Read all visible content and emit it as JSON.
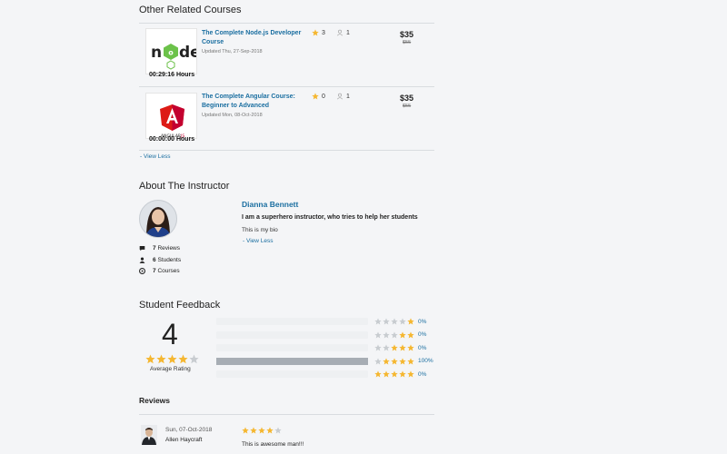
{
  "related": {
    "heading": "Other Related Courses",
    "courses": [
      {
        "title": "The Complete Node.js Developer Course",
        "updated": "Updated Thu, 27-Sep-2018",
        "hours": "00:29:16 Hours",
        "rating": "3",
        "students": "1",
        "price": "$35",
        "old_price": "$55",
        "logo_text": "node"
      },
      {
        "title": "The Complete Angular Course: Beginner to Advanced",
        "updated": "Updated Mon, 08-Oct-2018",
        "hours": "00:00:00 Hours",
        "rating": "0",
        "students": "1",
        "price": "$35",
        "old_price": "$55",
        "logo_text": "ANGULARJS"
      }
    ],
    "view_less": "- View Less"
  },
  "instructor": {
    "heading": "About The Instructor",
    "name": "Dianna Bennett",
    "tagline": "I am a superhero instructor, who tries to help her students",
    "bio": "This is my bio",
    "view_less": "- View Less",
    "stats": [
      {
        "icon": "comment-icon",
        "value": "7",
        "label": "Reviews"
      },
      {
        "icon": "user-icon",
        "value": "6",
        "label": "Students"
      },
      {
        "icon": "play-circle-icon",
        "value": "7",
        "label": "Courses"
      }
    ]
  },
  "feedback": {
    "heading": "Student Feedback",
    "average": "4",
    "average_label": "Average Rating",
    "average_stars": 4,
    "rows": [
      {
        "stars": 1,
        "percent": 0,
        "label": "0%"
      },
      {
        "stars": 2,
        "percent": 0,
        "label": "0%"
      },
      {
        "stars": 3,
        "percent": 0,
        "label": "0%"
      },
      {
        "stars": 4,
        "percent": 100,
        "label": "100%"
      },
      {
        "stars": 5,
        "percent": 0,
        "label": "0%"
      }
    ]
  },
  "reviews": {
    "heading": "Reviews",
    "items": [
      {
        "date": "Sun, 07-Oct-2018",
        "name": "Allen Haycraft",
        "stars": 4,
        "text": "This is awesome man!!!"
      }
    ]
  },
  "colors": {
    "accent": "#1a6ea0",
    "star": "#f5b731",
    "star_empty": "#c8ccd0"
  }
}
